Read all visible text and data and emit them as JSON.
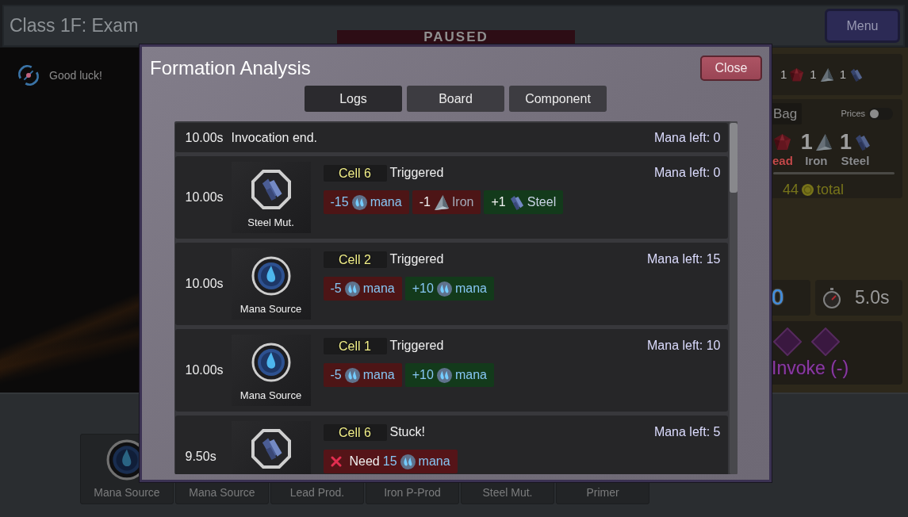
{
  "header": {
    "title": "Class 1F: Exam",
    "banner": "PAUSED",
    "menu_button": "Menu"
  },
  "message": {
    "text": "Good luck!"
  },
  "side_panel": {
    "resources": [
      {
        "count": "1",
        "kind": "lead"
      },
      {
        "count": "1",
        "kind": "iron"
      },
      {
        "count": "1",
        "kind": "steel"
      }
    ],
    "bag": {
      "tab": "Bag",
      "prices_label": "Prices",
      "prices_on": false,
      "items": [
        {
          "kind": "lead",
          "label": "ead",
          "color": "#c54a4a"
        },
        {
          "kind": "iron",
          "count": "1",
          "label": "Iron",
          "color": "#8a8b8d"
        },
        {
          "kind": "steel",
          "count": "1",
          "label": "Steel",
          "color": "#8a8b8d"
        }
      ],
      "total": {
        "value": "44",
        "label": "total"
      }
    },
    "counter": "0",
    "timer": "5.0s",
    "invoke_button": "Invoke (-)"
  },
  "hand": [
    {
      "label": "Mana Source",
      "kind": "source"
    },
    {
      "label": "Mana Source"
    },
    {
      "label": "Lead Prod."
    },
    {
      "label": "Iron P-Prod"
    },
    {
      "label": "Steel Mut."
    },
    {
      "label": "Primer"
    }
  ],
  "dialog": {
    "title": "Formation Analysis",
    "close_button": "Close",
    "tabs": [
      {
        "label": "Logs",
        "selected": true
      },
      {
        "label": "Board",
        "selected": false
      },
      {
        "label": "Component",
        "selected": false
      }
    ],
    "log": [
      {
        "kind": "end",
        "time": "10.00s",
        "text": "Invocation end.",
        "mana_left": "Mana left: 0"
      },
      {
        "kind": "event",
        "time": "10.00s",
        "card": {
          "kind": "mutator",
          "label": "Steel Mut."
        },
        "cell": "Cell 6",
        "status": "Triggered",
        "mana_left": "Mana left: 0",
        "effects": [
          {
            "kind": "mana",
            "gain": false,
            "unmet": false,
            "amount": "-15",
            "resource": "mana"
          },
          {
            "kind": "iron",
            "gain": false,
            "unmet": false,
            "amount": "-1",
            "resource": "Iron"
          },
          {
            "kind": "steel",
            "gain": true,
            "unmet": false,
            "amount": "+1",
            "resource": "Steel"
          }
        ]
      },
      {
        "kind": "event",
        "time": "10.00s",
        "card": {
          "kind": "source",
          "label": "Mana Source"
        },
        "cell": "Cell 2",
        "status": "Triggered",
        "mana_left": "Mana left: 15",
        "effects": [
          {
            "kind": "mana",
            "gain": false,
            "unmet": false,
            "amount": "-5",
            "resource": "mana"
          },
          {
            "kind": "mana",
            "gain": true,
            "unmet": false,
            "amount": "+10",
            "resource": "mana"
          }
        ]
      },
      {
        "kind": "event",
        "time": "10.00s",
        "card": {
          "kind": "source",
          "label": "Mana Source"
        },
        "cell": "Cell 1",
        "status": "Triggered",
        "mana_left": "Mana left: 10",
        "effects": [
          {
            "kind": "mana",
            "gain": false,
            "unmet": false,
            "amount": "-5",
            "resource": "mana"
          },
          {
            "kind": "mana",
            "gain": true,
            "unmet": false,
            "amount": "+10",
            "resource": "mana"
          }
        ]
      },
      {
        "kind": "event",
        "time": "9.50s",
        "card": {
          "kind": "mutator"
        },
        "cell": "Cell 6",
        "status": "Stuck!",
        "mana_left": "Mana left: 5",
        "effects": [
          {
            "kind": "mana",
            "gain": false,
            "unmet": true,
            "prefix": "Need",
            "amount": "15",
            "resource": "mana"
          }
        ]
      }
    ]
  }
}
